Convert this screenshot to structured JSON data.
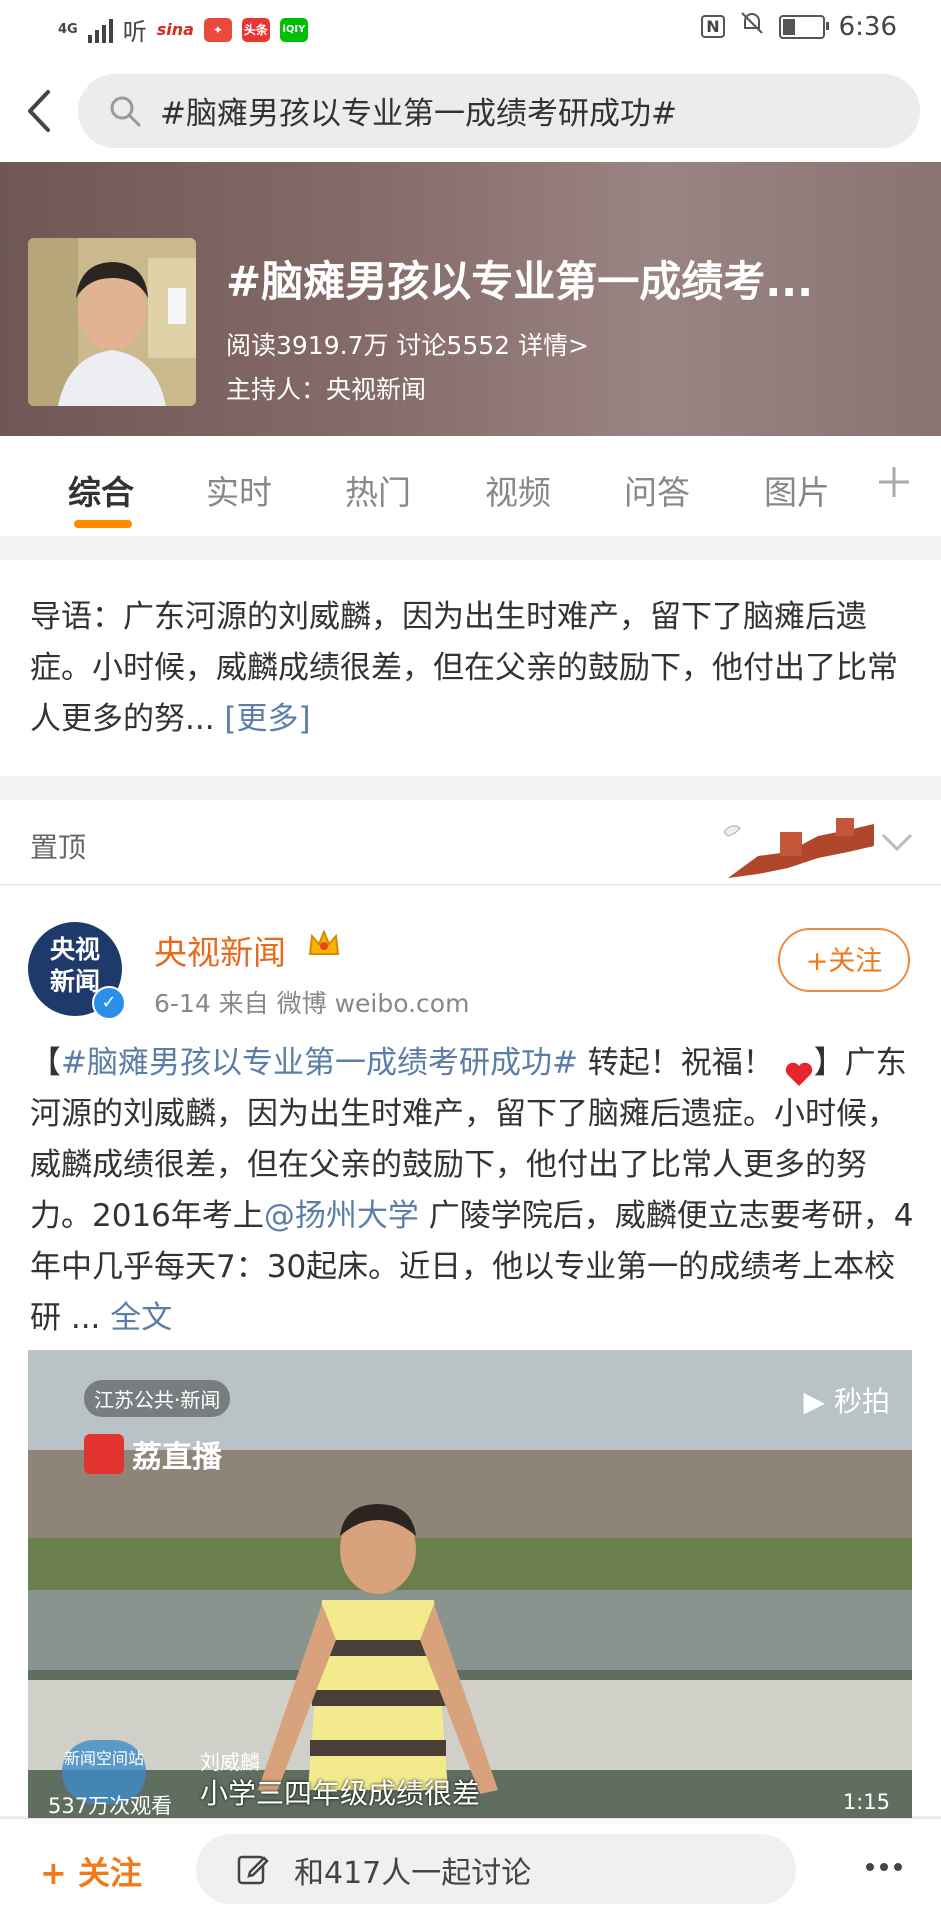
{
  "status": {
    "network": "4G",
    "left_icons": [
      "signal-icon",
      "ting-app-icon",
      "sina-app-icon",
      "weibo-news-icon",
      "toutiao-app-icon",
      "iqiyi-app-icon"
    ],
    "ting_label": "听",
    "sina_label": "sina",
    "toutiao_label": "头条",
    "iqiyi_label": "iQIY",
    "time": "6:36"
  },
  "search": {
    "query": "#脑瘫男孩以专业第一成绩考研成功#"
  },
  "topic": {
    "title": "#脑瘫男孩以专业第一成绩考...",
    "stats": "阅读3919.7万  讨论5552  详情>",
    "host": "主持人：央视新闻"
  },
  "tabs": [
    {
      "label": "综合"
    },
    {
      "label": "实时"
    },
    {
      "label": "热门"
    },
    {
      "label": "视频"
    },
    {
      "label": "问答"
    },
    {
      "label": "图片"
    }
  ],
  "intro": {
    "text": "导语：广东河源的刘威麟，因为出生时难产，留下了脑瘫后遗症。小时候，威麟成绩很差，但在父亲的鼓励下，他付出了比常人更多的努...",
    "more": "[更多]"
  },
  "pinned": {
    "label": "置顶"
  },
  "post": {
    "avatar_text_line1": "央视",
    "avatar_text_line2": "新闻",
    "author": "央视新闻",
    "meta": "6-14  来自 微博 weibo.com",
    "follow_label": "+关注",
    "text_prefix": "【",
    "hashtag": "#脑瘫男孩以专业第一成绩考研成功#",
    "text_part1": " 转起！祝福！",
    "text_part2": "】广东河源的刘威麟，因为出生时难产，留下了脑瘫后遗症。小时候，威麟成绩很差，但在父亲的鼓励下，他付出了比常人更多的努力。2016年考上",
    "mention": "@扬州大学",
    "text_part3": " 广陵学院后，威麟便立志要考研，4年中几乎每天7：30起床。近日，他以专业第一的成绩考上本校研 ... ",
    "full_text": "全文"
  },
  "video": {
    "logo_jiangsu": "江苏公共·新闻",
    "logo_lizhibo": "荔直播",
    "logo_miaopai": "秒拍",
    "name_tag": "刘威麟",
    "caption": "小学三四年级成绩很差",
    "views": "537万次观看",
    "duration": "1:15",
    "badge": "新闻空间站"
  },
  "bottom": {
    "follow": "+ 关注",
    "discuss": "和417人一起讨论"
  },
  "colors": {
    "accent_orange": "#f07a1a",
    "link_blue": "#5b7ea8",
    "banner": "#866c69"
  }
}
